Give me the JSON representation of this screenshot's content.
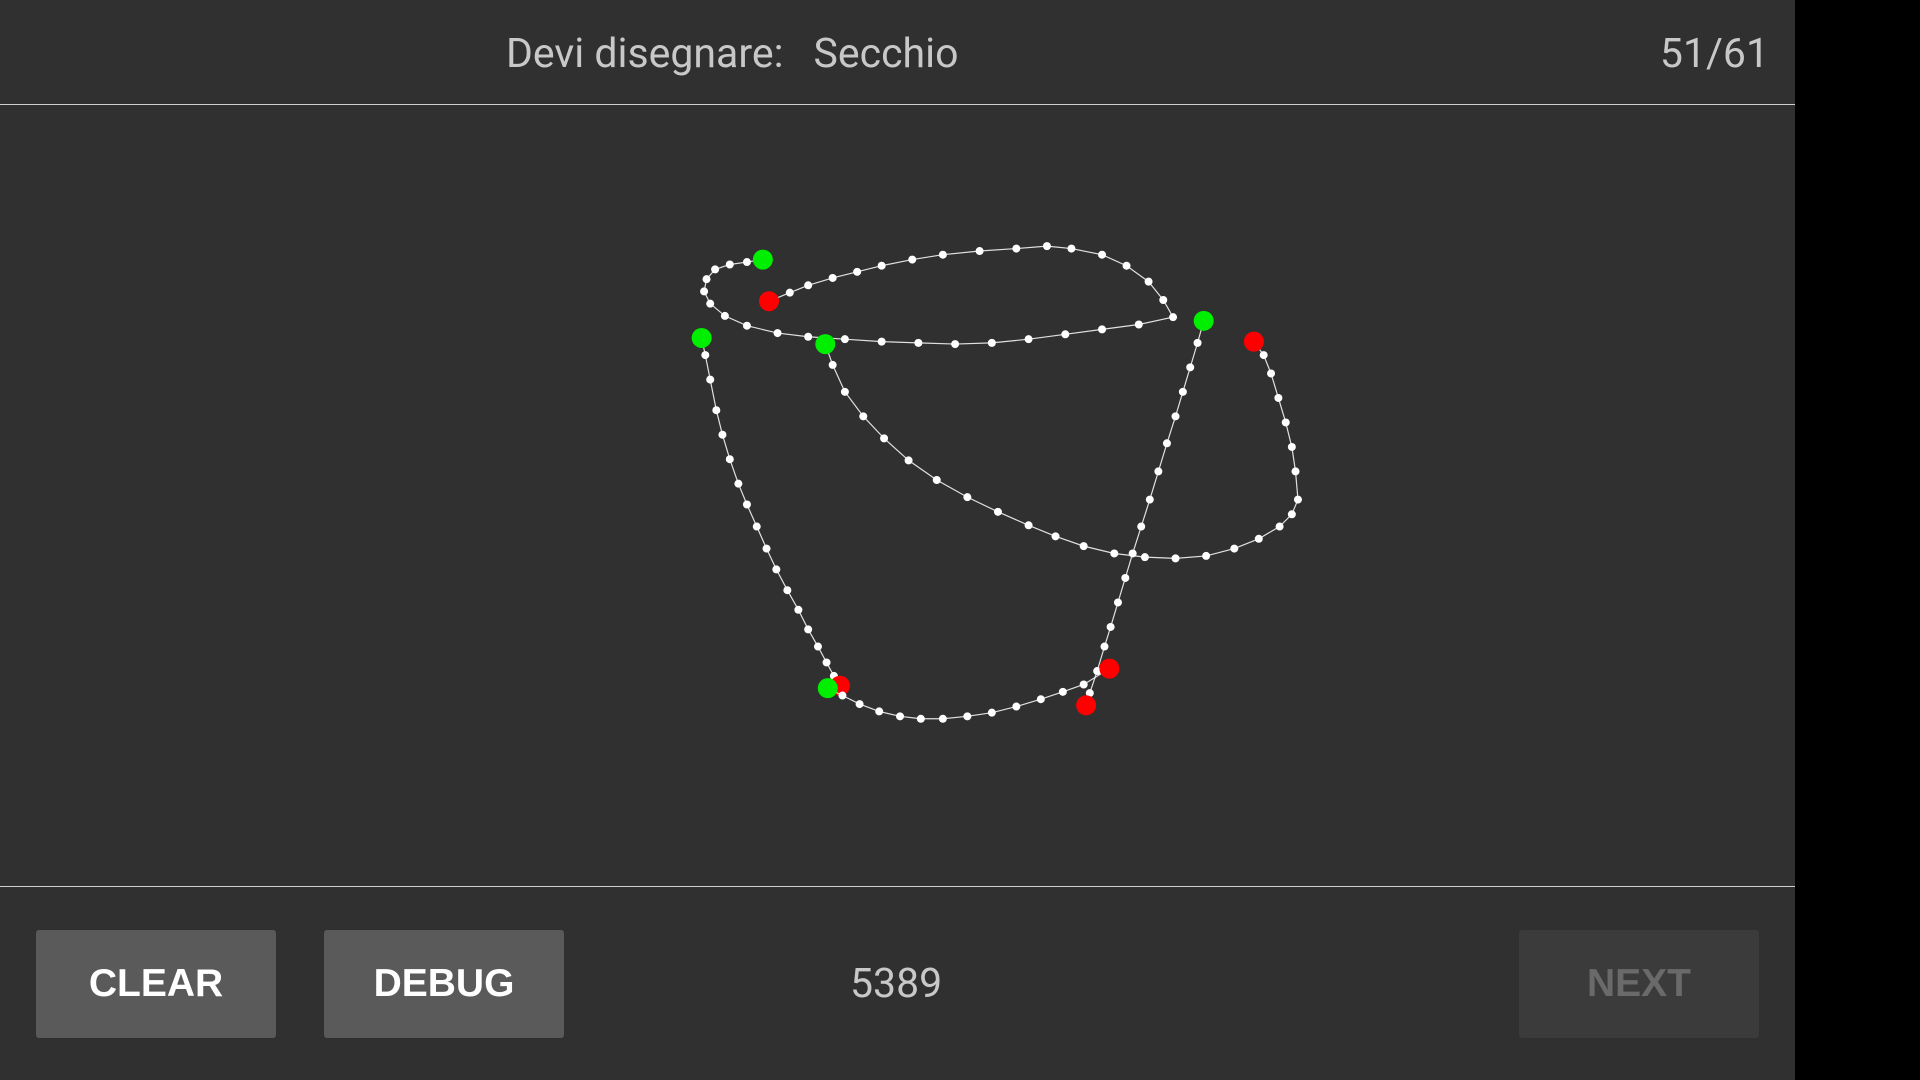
{
  "header": {
    "prompt_label": "Devi disegnare:",
    "prompt_word": "Secchio",
    "counter": "51/61"
  },
  "footer": {
    "clear_label": "CLEAR",
    "debug_label": "DEBUG",
    "score": "5389",
    "next_label": "NEXT",
    "next_enabled": false
  },
  "colors": {
    "background": "#303030",
    "stroke": "#ffffff",
    "stroke_start": "#00ee00",
    "stroke_end": "#ff0000",
    "button": "#5a5a5b",
    "button_disabled": "#3b3b3b"
  }
}
